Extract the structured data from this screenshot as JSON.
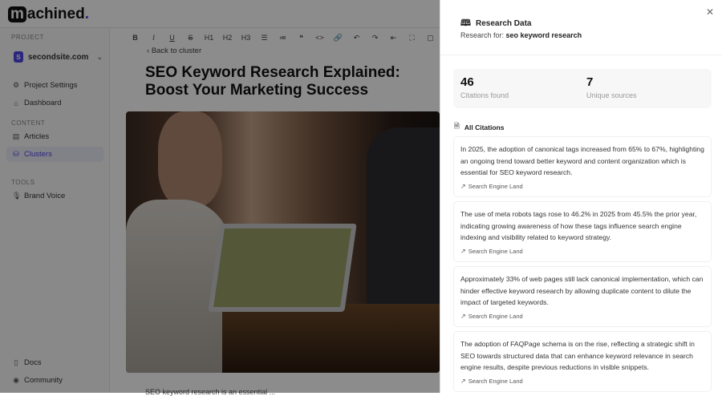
{
  "app": {
    "logo_mark": "m",
    "logo_rest": "achined",
    "logo_dot": "."
  },
  "sidebar": {
    "project_label": "PROJECT",
    "project": {
      "initial": "S",
      "name": "secondsite.com"
    },
    "items": [
      {
        "label": "Project Settings",
        "icon": "gear-icon"
      },
      {
        "label": "Dashboard",
        "icon": "home-icon"
      }
    ],
    "content_label": "CONTENT",
    "content_items": [
      {
        "label": "Articles",
        "icon": "document-icon"
      },
      {
        "label": "Clusters",
        "icon": "stack-icon",
        "active": true
      }
    ],
    "tools_label": "TOOLS",
    "tools_items": [
      {
        "label": "Brand Voice",
        "icon": "mic-icon"
      }
    ],
    "footer_items": [
      {
        "label": "Docs",
        "icon": "book-icon"
      },
      {
        "label": "Community",
        "icon": "discord-icon"
      }
    ]
  },
  "toolbar": {
    "buttons": [
      "B",
      "I",
      "U",
      "S",
      "H1",
      "H2",
      "H3",
      "☰",
      "≔",
      "❝",
      "<>",
      "🔗",
      "↶",
      "↷",
      "⇤",
      "⛶",
      "▢"
    ]
  },
  "editor": {
    "back": "Back to cluster",
    "title": "SEO Keyword Research Explained: Boost Your Marketing Success",
    "body_preview": "SEO keyword research is an essential ..."
  },
  "panel": {
    "title": "Research Data",
    "subtitle_prefix": "Research for: ",
    "keyword": "seo keyword research",
    "stats": [
      {
        "value": "46",
        "label": "Citations found"
      },
      {
        "value": "7",
        "label": "Unique sources"
      }
    ],
    "all_citations": "All Citations",
    "citations": [
      {
        "text": "In 2025, the adoption of canonical tags increased from 65% to 67%, highlighting an ongoing trend toward better keyword and content organization which is essential for SEO keyword research.",
        "source": "Search Engine Land"
      },
      {
        "text": "The use of meta robots tags rose to 46.2% in 2025 from 45.5% the prior year, indicating growing awareness of how these tags influence search engine indexing and visibility related to keyword strategy.",
        "source": "Search Engine Land"
      },
      {
        "text": "Approximately 33% of web pages still lack canonical implementation, which can hinder effective keyword research by allowing duplicate content to dilute the impact of targeted keywords.",
        "source": "Search Engine Land"
      },
      {
        "text": "The adoption of FAQPage schema is on the rise, reflecting a strategic shift in SEO towards structured data that can enhance keyword relevance in search engine results, despite previous reductions in visible snippets.",
        "source": "Search Engine Land"
      }
    ]
  },
  "colors": {
    "accent": "#4f46e5"
  }
}
